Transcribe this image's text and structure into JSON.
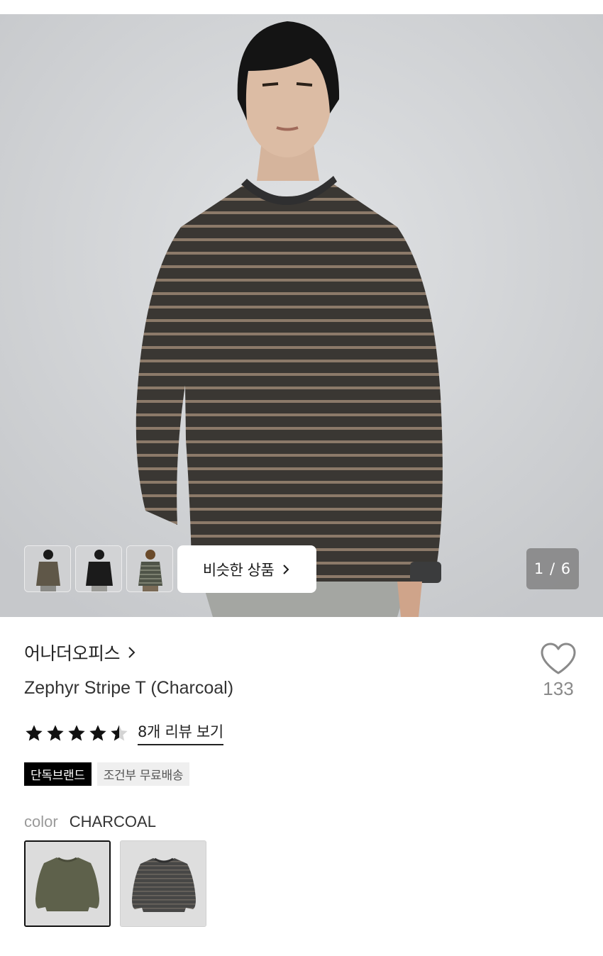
{
  "gallery": {
    "similar_button_label": "비슷한 상품",
    "page_counter": "1 / 6",
    "thumbnails": [
      "olive",
      "black",
      "stripe"
    ]
  },
  "product": {
    "brand": "어나더오피스",
    "name": "Zephyr Stripe T (Charcoal)",
    "like_count": "133",
    "rating": 4.5,
    "review_link": "8개 리뷰 보기",
    "badges": [
      "단독브랜드",
      "조건부 무료배송"
    ],
    "color_label": "color",
    "color_value": "CHARCOAL",
    "color_options": [
      "olive",
      "charcoal"
    ]
  },
  "icons": {
    "similar_chevron": "chevron-right-icon",
    "brand_chevron": "chevron-right-icon",
    "like": "heart-outline-icon",
    "rating": "star-icon"
  },
  "colors": {
    "shirt_dark": "#3d3a36",
    "shirt_stripe": "#8c7c6c",
    "olive": "#5e614b",
    "charcoal": "#4e4e4c"
  }
}
